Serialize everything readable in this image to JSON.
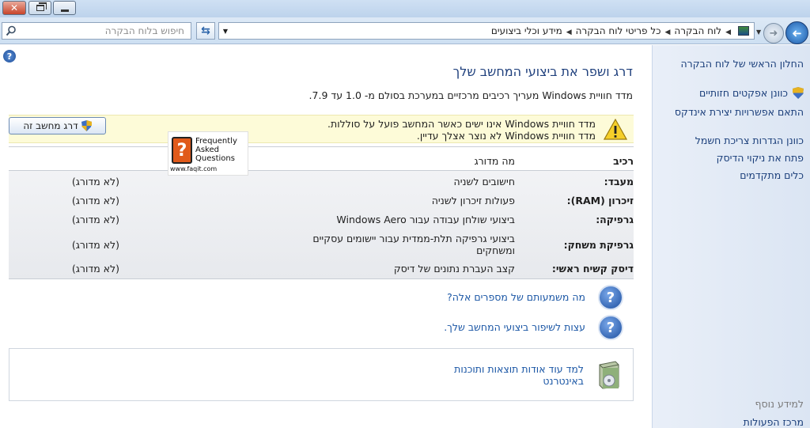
{
  "window": {
    "close_glyph": "✕"
  },
  "search": {
    "placeholder": "חיפוש בלוח הבקרה"
  },
  "breadcrumb": {
    "items": [
      "לוח הבקרה",
      "כל פריטי לוח הבקרה",
      "מידע וכלי ביצועים"
    ]
  },
  "nav": {
    "home": "החלון הראשי של לוח הבקרה",
    "links": [
      "כוונן אפקטים חזותיים",
      "התאם אפשרויות יצירת אינדקס",
      "כוונן הגדרות צריכת חשמל",
      "פתח את ניקוי הדיסק",
      "כלים מתקדמים"
    ],
    "see_also": "למידע נוסף",
    "action_center": "מרכז הפעולות"
  },
  "main": {
    "title": "דרג ושפר את ביצועי המחשב שלך",
    "description": "מדד חוויית Windows מעריך רכיבים מרכזיים במערכת בסולם מ- 1.0 עד 7.9.",
    "warning_line1": "מדד חוויית Windows אינו ישים כאשר המחשב פועל על סוללות.",
    "warning_line2": "מדד חוויית Windows לא נוצר אצלך עדיין.",
    "rate_button": "דרג מחשב זה"
  },
  "table": {
    "header_component": "רכיב",
    "header_rated": "מה מדורג",
    "rows": [
      {
        "component": "מעבד:",
        "rated": "חישובים לשניה",
        "score": "(לא מדורג)"
      },
      {
        "component": "זיכרון (RAM):",
        "rated": "פעולות זיכרון לשניה",
        "score": "(לא מדורג)"
      },
      {
        "component": "גרפיקה:",
        "rated": "ביצועי שולחן עבודה עבור Windows Aero",
        "score": "(לא מדורג)"
      },
      {
        "component": "גרפיקת משחק:",
        "rated": "ביצועי גרפיקה תלת-ממדית עבור יישומים עסקיים ומשחקים",
        "score": "(לא מדורג)"
      },
      {
        "component": "דיסק קשיח ראשי:",
        "rated": "קצב העברת נתונים של דיסק",
        "score": "(לא מדורג)"
      }
    ]
  },
  "faq_logo": {
    "line1": "Frequently",
    "line2": "Asked",
    "line3": "Questions",
    "url": "www.faqit.com"
  },
  "help_links": {
    "meaning": "מה משמעותם של מספרים אלה?",
    "tips": "עצות לשיפור ביצועי המחשב שלך."
  },
  "info": {
    "link": "למד עוד אודות תוצאות ותוכנות באינטרנט"
  },
  "colors": {
    "link": "#1a56a5",
    "title": "#1e3f7c",
    "warning_bg": "#fdfbd8"
  }
}
